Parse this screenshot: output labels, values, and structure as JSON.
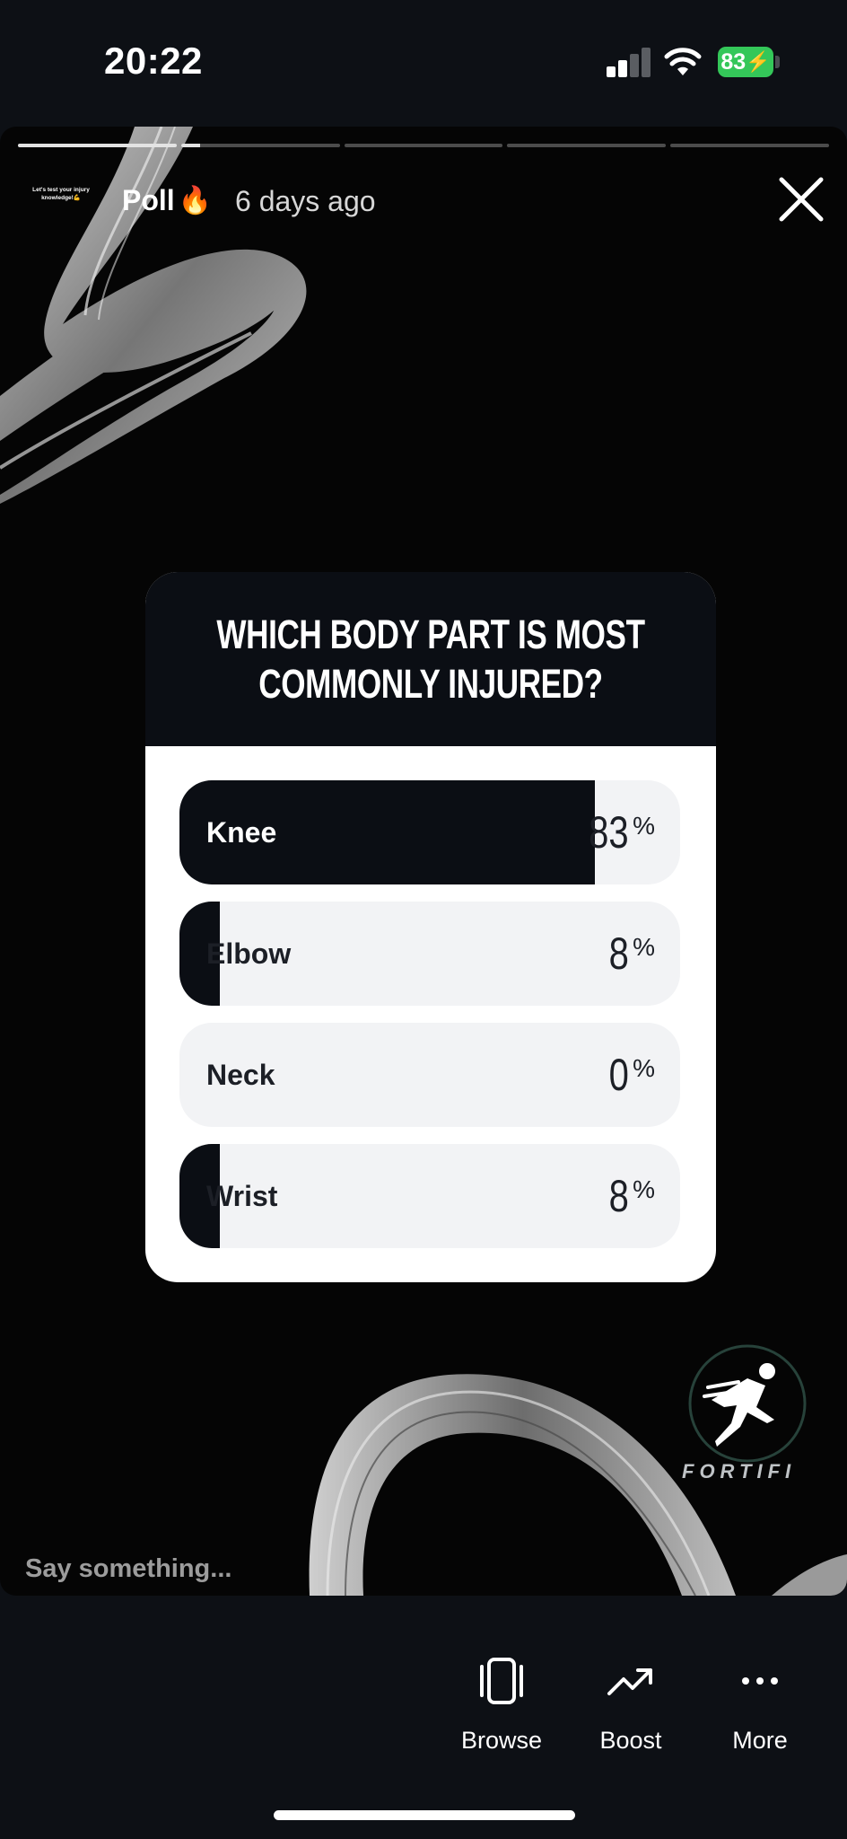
{
  "status_bar": {
    "time": "20:22",
    "battery": "83",
    "icons": [
      "signal-icon",
      "wifi-icon",
      "battery-icon"
    ]
  },
  "story": {
    "progress": {
      "segments": 5,
      "active_index": 1,
      "active_fill": 0.07
    },
    "thumb_text": "Let's test your injury knowledge!💪",
    "title": "Poll",
    "title_emoji": "🔥",
    "time_ago": "6 days ago"
  },
  "poll": {
    "question": "WHICH BODY PART IS MOST COMMONLY INJURED?",
    "options": [
      {
        "label": "Knee",
        "percent": "83",
        "sign": "%",
        "fill": 0.83
      },
      {
        "label": "Elbow",
        "percent": "8",
        "sign": "%",
        "fill": 0.08
      },
      {
        "label": "Neck",
        "percent": "0",
        "sign": "%",
        "fill": 0
      },
      {
        "label": "Wrist",
        "percent": "8",
        "sign": "%",
        "fill": 0.08
      }
    ]
  },
  "brand": {
    "name": "FORTIFI"
  },
  "composer": {
    "placeholder": "Say something..."
  },
  "toolbar": {
    "browse": "Browse",
    "boost": "Boost",
    "more": "More"
  },
  "colors": {
    "background": "#0d1015",
    "card_header": "#0b0e14",
    "option_bg": "#f2f3f5",
    "battery": "#34c759"
  }
}
